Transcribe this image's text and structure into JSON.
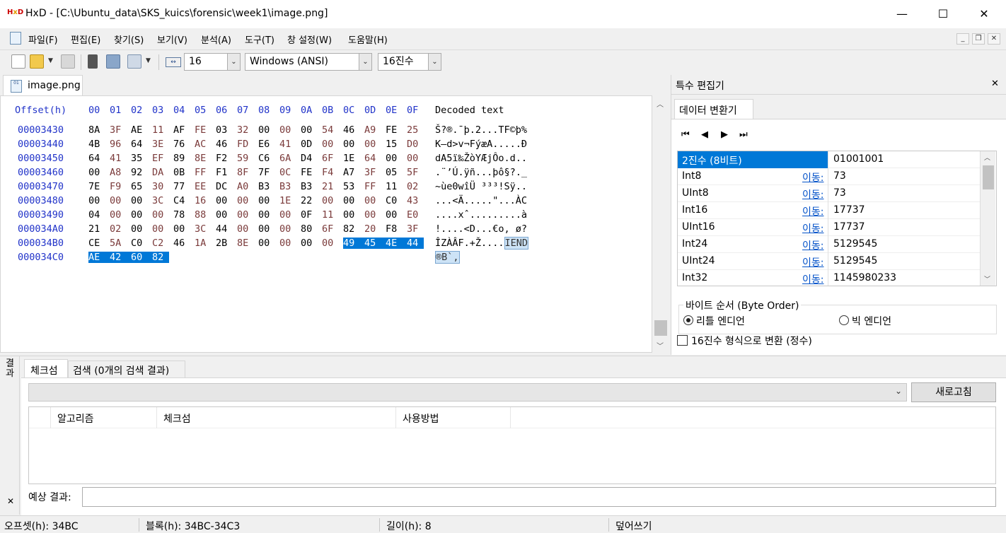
{
  "window": {
    "title": "HxD - [C:\\Ubuntu_data\\SKS_kuics\\forensic\\week1\\image.png]",
    "min_glyph": "—",
    "max_glyph": "☐",
    "close_glyph": "✕"
  },
  "menu": [
    "파일(F)",
    "편집(E)",
    "찾기(S)",
    "보기(V)",
    "분석(A)",
    "도구(T)",
    "창 설정(W)",
    "도움말(H)"
  ],
  "toolbar": {
    "bytes_per_row": "16",
    "charset": "Windows (ANSI)",
    "offset_base": "16진수"
  },
  "doc_tab": "image.png",
  "hex": {
    "header_offset": "Offset(h)",
    "header_cols": [
      "00",
      "01",
      "02",
      "03",
      "04",
      "05",
      "06",
      "07",
      "08",
      "09",
      "0A",
      "0B",
      "0C",
      "0D",
      "0E",
      "0F"
    ],
    "header_decoded": "Decoded text",
    "rows": [
      {
        "offset": "00003430",
        "bytes": [
          "8A",
          "3F",
          "AE",
          "11",
          "AF",
          "FE",
          "03",
          "32",
          "00",
          "00",
          "00",
          "54",
          "46",
          "A9",
          "FE",
          "25"
        ],
        "text": "Š?®.¯þ.2...TF©þ%"
      },
      {
        "offset": "00003440",
        "bytes": [
          "4B",
          "96",
          "64",
          "3E",
          "76",
          "AC",
          "46",
          "FD",
          "E6",
          "41",
          "0D",
          "00",
          "00",
          "00",
          "15",
          "D0"
        ],
        "text": "K–d>v¬FýæA.....Ð"
      },
      {
        "offset": "00003450",
        "bytes": [
          "64",
          "41",
          "35",
          "EF",
          "89",
          "8E",
          "F2",
          "59",
          "C6",
          "6A",
          "D4",
          "6F",
          "1E",
          "64",
          "00",
          "00"
        ],
        "text": "dA5ï‰ŽòYÆjÔo.d.."
      },
      {
        "offset": "00003460",
        "bytes": [
          "00",
          "A8",
          "92",
          "DA",
          "0B",
          "FF",
          "F1",
          "8F",
          "7F",
          "0C",
          "FE",
          "F4",
          "A7",
          "3F",
          "05",
          "5F"
        ],
        "text": ".¨’Ú.ÿñ...þô§?._"
      },
      {
        "offset": "00003470",
        "bytes": [
          "7E",
          "F9",
          "65",
          "30",
          "77",
          "EE",
          "DC",
          "A0",
          "B3",
          "B3",
          "B3",
          "21",
          "53",
          "FF",
          "11",
          "02"
        ],
        "text": "~ùe0wîÜ ³³³!Sÿ.."
      },
      {
        "offset": "00003480",
        "bytes": [
          "00",
          "00",
          "00",
          "3C",
          "C4",
          "16",
          "00",
          "00",
          "00",
          "1E",
          "22",
          "00",
          "00",
          "00",
          "C0",
          "43"
        ],
        "text": "...<Ä.....\"...ÀC"
      },
      {
        "offset": "00003490",
        "bytes": [
          "04",
          "00",
          "00",
          "00",
          "78",
          "88",
          "00",
          "00",
          "00",
          "00",
          "0F",
          "11",
          "00",
          "00",
          "00",
          "E0"
        ],
        "text": "....xˆ.........à"
      },
      {
        "offset": "000034A0",
        "bytes": [
          "21",
          "02",
          "00",
          "00",
          "00",
          "3C",
          "44",
          "00",
          "00",
          "00",
          "80",
          "6F",
          "82",
          "20",
          "F8",
          "3F"
        ],
        "text": "!....<D...€o‚ ø?"
      },
      {
        "offset": "000034B0",
        "bytes": [
          "CE",
          "5A",
          "C0",
          "C2",
          "46",
          "1A",
          "2B",
          "8E",
          "00",
          "00",
          "00",
          "00",
          "49",
          "45",
          "4E",
          "44"
        ],
        "text": "ÎZÀÂF.+Ž....IEND"
      },
      {
        "offset": "000034C0",
        "bytes": [
          "AE",
          "42",
          "60",
          "82"
        ],
        "text": "®B`‚"
      }
    ]
  },
  "special_editor": {
    "title": "특수 편집기",
    "tab": "데이터 변환기",
    "rows": [
      {
        "name": "2진수 (8비트)",
        "link": "",
        "value": "01001001"
      },
      {
        "name": "Int8",
        "link": "이동:",
        "value": "73"
      },
      {
        "name": "UInt8",
        "link": "이동:",
        "value": "73"
      },
      {
        "name": "Int16",
        "link": "이동:",
        "value": "17737"
      },
      {
        "name": "UInt16",
        "link": "이동:",
        "value": "17737"
      },
      {
        "name": "Int24",
        "link": "이동:",
        "value": "5129545"
      },
      {
        "name": "UInt24",
        "link": "이동:",
        "value": "5129545"
      },
      {
        "name": "Int32",
        "link": "이동:",
        "value": "1145980233"
      }
    ],
    "byte_order_title": "바이트 순서 (Byte Order)",
    "little_endian": "리틀 엔디언",
    "big_endian": "빅 엔디언",
    "hex_format_label": "16진수 형식으로 변환 (정수)"
  },
  "results": {
    "side_label": "결과",
    "tab_checksum": "체크섬",
    "tab_search": "검색 (0개의 검색 결과)",
    "refresh": "새로고침",
    "col_algorithm": "알고리즘",
    "col_checksum": "체크섬",
    "col_usage": "사용방법",
    "expected_label": "예상 결과:"
  },
  "status": {
    "offset": "오프셋(h): 34BC",
    "block": "블록(h): 34BC-34C3",
    "length": "길이(h): 8",
    "mode": "덮어쓰기"
  }
}
